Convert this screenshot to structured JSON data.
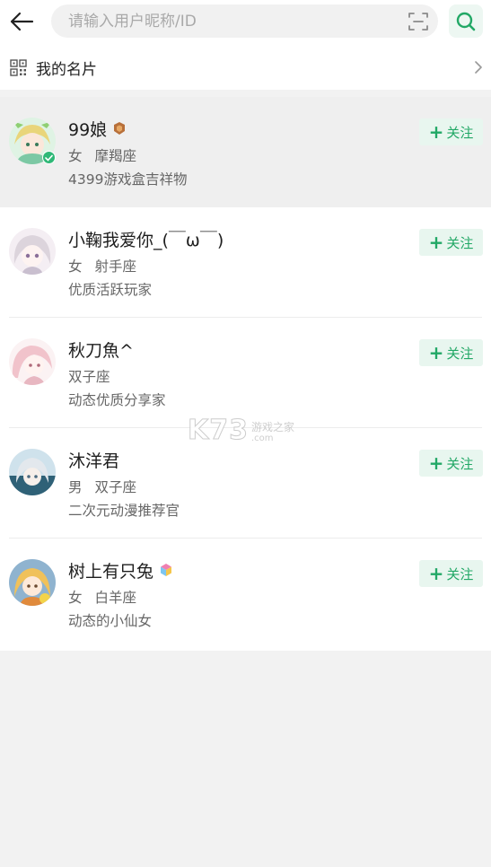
{
  "header": {
    "search_placeholder": "请输入用户昵称/ID",
    "back_icon": "arrow-left-icon",
    "scan_icon": "scan-icon",
    "search_icon": "search-icon",
    "accent_color": "#22a866"
  },
  "my_card": {
    "label": "我的名片"
  },
  "users": [
    {
      "nickname": "99娘",
      "gender": "女",
      "zodiac": "摩羯座",
      "desc": "4399游戏盒吉祥物",
      "follow": "关注",
      "verified": true,
      "badge": "medal-badge-icon"
    },
    {
      "nickname": "小鞠我爱你_(￣ω￣)",
      "gender": "女",
      "zodiac": "射手座",
      "desc": "优质活跃玩家",
      "follow": "关注"
    },
    {
      "nickname": "秋刀魚^",
      "gender": "",
      "zodiac": "双子座",
      "desc": "动态优质分享家",
      "follow": "关注"
    },
    {
      "nickname": "沐洋君",
      "gender": "男",
      "zodiac": "双子座",
      "desc": "二次元动漫推荐官",
      "follow": "关注"
    },
    {
      "nickname": "树上有只兔",
      "gender": "女",
      "zodiac": "白羊座",
      "desc": "动态的小仙女",
      "follow": "关注",
      "badge": "cube-badge-icon"
    }
  ],
  "watermark": {
    "logo": "K73",
    "cn": "游戏之家",
    "com": ".com"
  }
}
